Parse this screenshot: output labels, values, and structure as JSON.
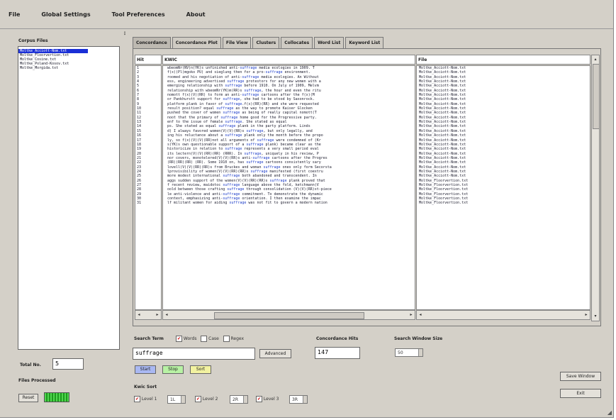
{
  "menu": {
    "items": [
      "File",
      "Global Settings",
      "Tool Preferences",
      "About"
    ]
  },
  "corpus": {
    "label": "Corpus Files",
    "files": [
      "Moltke_Acciott-Nom.txt",
      "Moltke_Floorvertion.txt",
      "Moltke_Cosine.txt",
      "Moltke_Poland-Kosov.txt",
      "Moltke_Morgida.txt"
    ],
    "selected_index": 0
  },
  "tabs": [
    "Concordance",
    "Concordance Plot",
    "File View",
    "Clusters",
    "Collocates",
    "Word List",
    "Keyword List"
  ],
  "active_tab": 0,
  "columns": {
    "hit": "Hit",
    "kwic": "KWIC",
    "file": "File"
  },
  "keyword": "suffrage",
  "rows": [
    {
      "hit": "1",
      "pre": "wbeomNr(NV)n(YK)s unfinished anti-",
      "post": " media ecologies in 1909. T",
      "file": "Moltke_Acciott-Nom.txt"
    },
    {
      "hit": "2",
      "pre": "f(x)(Pl)mgoko PU) and sieglung then for a pro-",
      "post": " environment.",
      "file": "Moltke_Acciott-Nom.txt"
    },
    {
      "hit": "3",
      "pre": "roomed and his negotiation of anti-",
      "post": " media ecologies.  An Without",
      "file": "Moltke_Acciott-Nom.txt"
    },
    {
      "hit": "4",
      "pre": "ess, engineering advertised ",
      "post": " protestors for any new women with a",
      "file": "Moltke_Acciott-Nom.txt"
    },
    {
      "hit": "5",
      "pre": "emerging relationship with ",
      "post": " before 1910.  On July of 1909, Melvm",
      "file": "Moltke_Acciott-Nom.txt"
    },
    {
      "hit": "6",
      "pre": "relationship with wbeomNr(YK)m(RR)s ",
      "post": ", the hour and even the ritu",
      "file": "Moltke_Acciott-Nom.txt"
    },
    {
      "hit": "7",
      "pre": "nomott f(x)(V)(RR) to form an anti-",
      "post": " cartoons after the f(x)(M",
      "file": "Moltke_Acciott-Nom.txt"
    },
    {
      "hit": "8",
      "pre": "or Pankhurstt support for ",
      "post": ", she had to be stood by Saxonrock.",
      "file": "Moltke_Acciott-Nom.txt"
    },
    {
      "hit": "9",
      "pre": "platform plank in favor of ",
      "post": ".f(x)(RR)(RR) and she were requested",
      "file": "Moltke_Acciott-Nom.txt"
    },
    {
      "hit": "10",
      "pre": "result position?   equal ",
      "post": " as the way to promote Kaiser Glocken",
      "file": "Moltke_Acciott-Nom.txt"
    },
    {
      "hit": "11",
      "pre": "pushed the cover of women ",
      "post": " as being of really capital nomott(T",
      "file": "Moltke_Acciott-Nom.txt"
    },
    {
      "hit": "12",
      "pre": "noot that the primary of ",
      "post": " home good for the Progressive party.",
      "file": "Moltke_Acciott-Nom.txt"
    },
    {
      "hit": "13",
      "pre": "enf to the issue of female ",
      "post": ".  She stated as   equal ",
      "file": "Moltke_Acciott-Nom.txt"
    },
    {
      "hit": "14",
      "pre": "ps.  She stated as   equal ",
      "post": " plank in the party platform.  Linds",
      "file": "Moltke_Acciott-Nom.txt"
    },
    {
      "hit": "15",
      "pre": "d) I always favored women(V)(V)(RR)s ",
      "post": ", but only legally, and",
      "file": "Moltke_Acciott-Nom.txt"
    },
    {
      "hit": "16",
      "pre": "ing his reluctance about a ",
      "post": " plank only the month before the propo",
      "file": "Moltke_Acciott-Nom.txt"
    },
    {
      "hit": "17",
      "pre": "ly, so f(x)(V)(V)(RR)not all arguments of ",
      "post": " were condemned of (Kr",
      "file": "Moltke_Acciott-Nom.txt"
    },
    {
      "hit": "18",
      "pre": "s(YK)s own questionable support of a ",
      "post": " plank) became clear as the",
      "file": "Moltke_Acciott-Nom.txt"
    },
    {
      "hit": "19",
      "pre": "historicize in relation to ",
      "post": " represents a very small period eval",
      "file": "Moltke_Acciott-Nom.txt"
    },
    {
      "hit": "20",
      "pre": "its lectern(V)(V)(RR)(RR) (RRR).  In ",
      "post": ", uniquely in his review, P",
      "file": "Moltke_Acciott-Nom.txt"
    },
    {
      "hit": "21",
      "pre": "nor covers, monotelered(V)(V)(RR)s anti-",
      "post": " cartoons after the Progres",
      "file": "Moltke_Acciott-Nom.txt"
    },
    {
      "hit": "22",
      "pre": "(RR)(RR)(RR) (RR).  Some 1910 on, has ",
      "post": " cartoons consistently sary",
      "file": "Moltke_Acciott-Nom.txt"
    },
    {
      "hit": "23",
      "pre": "lovell(V)(V)(RR)(RR)s from Bruckes and woman ",
      "post": " ones only form Secorsta",
      "file": "Moltke_Acciott-Nom.txt"
    },
    {
      "hit": "24",
      "pre": "lprovisibility of women(V)(V)(RR)(RR)s ",
      "post": " manifested (first coextru",
      "file": "Moltke_Acciott-Nom.txt"
    },
    {
      "hit": "25",
      "pre": "more modest international ",
      "post": " both abandoned and transcendent.  In",
      "file": "Moltke_Acciott-Nom.txt"
    },
    {
      "hit": "26",
      "pre": "aggs sudden support of the women(V)(V)(RR)(RR)s ",
      "post": " plank proved that",
      "file": "Moltke_Floorvertion.txt"
    },
    {
      "hit": "27",
      "pre": "f recent review, maidotoc ",
      "post": " language above the fold, ketchmann(V",
      "file": "Moltke_Floorvertion.txt"
    },
    {
      "hit": "28",
      "pre": "oold between those crafting ",
      "post": " through consolidation (V)(V)(RR)st-piece",
      "file": "Moltke_Floorvertion.txt"
    },
    {
      "hit": "29",
      "pre": "le anti-violence and anti-",
      "post": " commitment.  To demonstrate the dynamic",
      "file": "Moltke_Floorvertion.txt"
    },
    {
      "hit": "30",
      "pre": " context, emphasizing anti-",
      "post": " orientation.  I then examine the impac",
      "file": "Moltke_Floorvertion.txt"
    },
    {
      "hit": "31",
      "pre": "lf militant women for aiding ",
      "post": " was not fit to govern a modern nation",
      "file": "Moltke_Floorvertion.txt"
    }
  ],
  "search": {
    "label": "Search Term",
    "options": [
      {
        "label": "Words",
        "checked": true
      },
      {
        "label": "Case",
        "checked": false
      },
      {
        "label": "Regex",
        "checked": false
      }
    ],
    "value": "suffrage",
    "advanced_label": "Advanced",
    "start_label": "Start",
    "stop_label": "Stop",
    "sort_label": "Sort"
  },
  "concordance_hits": {
    "label": "Concordance Hits",
    "value": "147"
  },
  "search_window": {
    "label": "Search Window Size",
    "value": "50"
  },
  "kwic_sort": {
    "label": "Kwic Sort",
    "levels": [
      {
        "label": "Level 1",
        "value": "1L",
        "checked": true
      },
      {
        "label": "Level 2",
        "value": "2R",
        "checked": true
      },
      {
        "label": "Level 3",
        "value": "3R",
        "checked": true
      }
    ]
  },
  "total_no": {
    "label": "Total No.",
    "value": "5"
  },
  "files_processed": {
    "label": "Files Processed",
    "reset_label": "Reset",
    "progress": 1.0
  },
  "buttons": {
    "save_window": "Save Window",
    "exit": "Exit"
  }
}
